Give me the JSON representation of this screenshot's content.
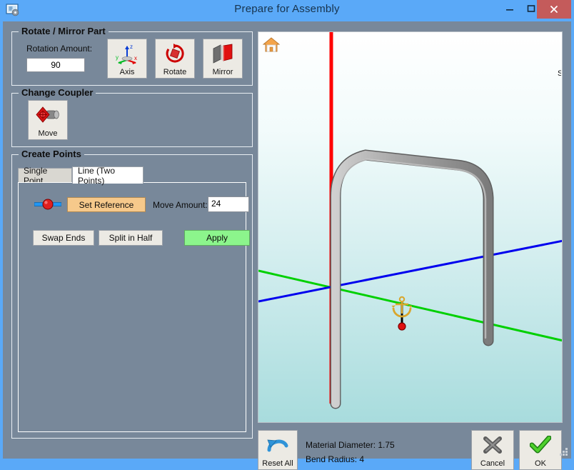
{
  "window": {
    "title": "Prepare for Assembly",
    "icon": "app-window-settings-icon",
    "minimize_label": "Minimize",
    "maximize_label": "Maximize",
    "close_label": "Close"
  },
  "rotate_mirror": {
    "group_title": "Rotate / Mirror Part",
    "rotation_label": "Rotation Amount:",
    "rotation_value": "90",
    "buttons": [
      {
        "label": "Axis",
        "icon": "axis-triad-icon"
      },
      {
        "label": "Rotate",
        "icon": "rotate-arrow-icon"
      },
      {
        "label": "Mirror",
        "icon": "mirror-plane-icon"
      }
    ]
  },
  "change_coupler": {
    "group_title": "Change Coupler",
    "buttons": [
      {
        "label": "Move",
        "icon": "coupler-move-icon"
      }
    ]
  },
  "create_points": {
    "group_title": "Create Points",
    "tabs": [
      {
        "label": "Single Point",
        "active": false
      },
      {
        "label": "Line (Two Points)",
        "active": true
      }
    ],
    "line_tab": {
      "endpoint_icon": "line-endpoint-icon",
      "set_reference_label": "Set Reference",
      "move_amount_label": "Move Amount:",
      "move_amount_value": "24",
      "swap_ends_label": "Swap Ends",
      "split_in_half_label": "Split in Half",
      "apply_label": "Apply"
    }
  },
  "viewport": {
    "home_icon": "home-view-icon",
    "edge_glyph": "S",
    "anchor_icon": "anchor-origin-icon",
    "axes": {
      "x_color": "#00d000",
      "y_color": "#0000ee",
      "z_color": "#ff0000"
    },
    "part_color": "#9a9a9a"
  },
  "footer": {
    "reset_all_label": "Reset All",
    "reset_all_icon": "undo-arrow-icon",
    "material_diameter": "Material Diameter: 1.75",
    "bend_radius": "Bend Radius: 4",
    "cancel_label": "Cancel",
    "cancel_icon": "x-mark-icon",
    "ok_label": "OK",
    "ok_icon": "check-mark-icon"
  },
  "colors": {
    "titlebar": "#5aa9f8",
    "panel": "#78889a",
    "close_button": "#c45b5b",
    "accent_orange": "#f6c98b",
    "accent_green": "#8cf58c"
  }
}
